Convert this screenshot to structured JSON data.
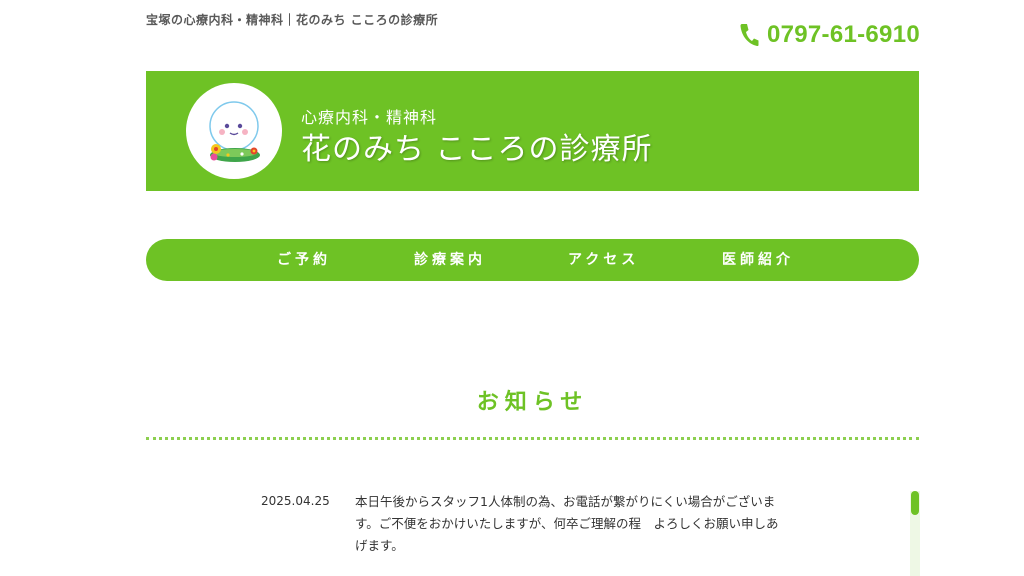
{
  "header": {
    "caption": "宝塚の心療内科・精神科｜花のみち こころの診療所",
    "phone": "0797-61-6910"
  },
  "banner": {
    "subtitle": "心療内科・精神科",
    "clinic_name": "花のみち こころの診療所"
  },
  "nav": {
    "items": [
      {
        "label": "ご予約"
      },
      {
        "label": "診療案内"
      },
      {
        "label": "アクセス"
      },
      {
        "label": "医師紹介"
      }
    ]
  },
  "news": {
    "title": "お知らせ",
    "items": [
      {
        "date": "2025.04.25",
        "text": "本日午後からスタッフ1人体制の為、お電話が繋がりにくい場合がございます。ご不便をおかけいたしますが、何卒ご理解の程　よろしくお願い申しあげます。"
      }
    ]
  },
  "colors": {
    "brand_green": "#6ec225",
    "text": "#333333"
  },
  "icons": {
    "phone": "phone-icon",
    "logo": "clinic-logo-character"
  }
}
